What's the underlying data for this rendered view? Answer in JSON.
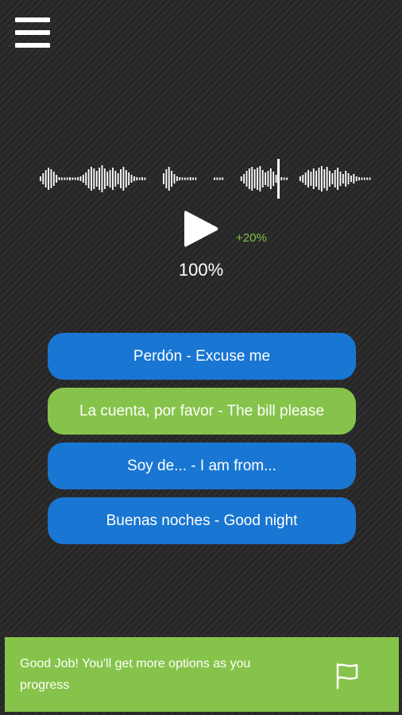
{
  "menu": {
    "icon": "hamburger-menu-icon"
  },
  "player": {
    "play_icon": "play-icon",
    "speed_increment": "+20%",
    "speed": "100%"
  },
  "options": [
    {
      "label": "Perdón - Excuse me",
      "state": "default",
      "color": "#1976d2"
    },
    {
      "label": "La cuenta, por favor - The bill please",
      "state": "correct",
      "color": "#86c34a"
    },
    {
      "label": "Soy de... - I am from...",
      "state": "default",
      "color": "#1976d2"
    },
    {
      "label": "Buenas noches - Good night",
      "state": "default",
      "color": "#1976d2"
    }
  ],
  "feedback": {
    "message": "Good Job! You'll get more options as you progress",
    "flag_icon": "flag-icon",
    "color": "#86c34a"
  },
  "colors": {
    "accent_green": "#86c34a",
    "option_blue": "#1976d2",
    "speed_green": "#7cc142",
    "background": "#2b2b2b"
  }
}
